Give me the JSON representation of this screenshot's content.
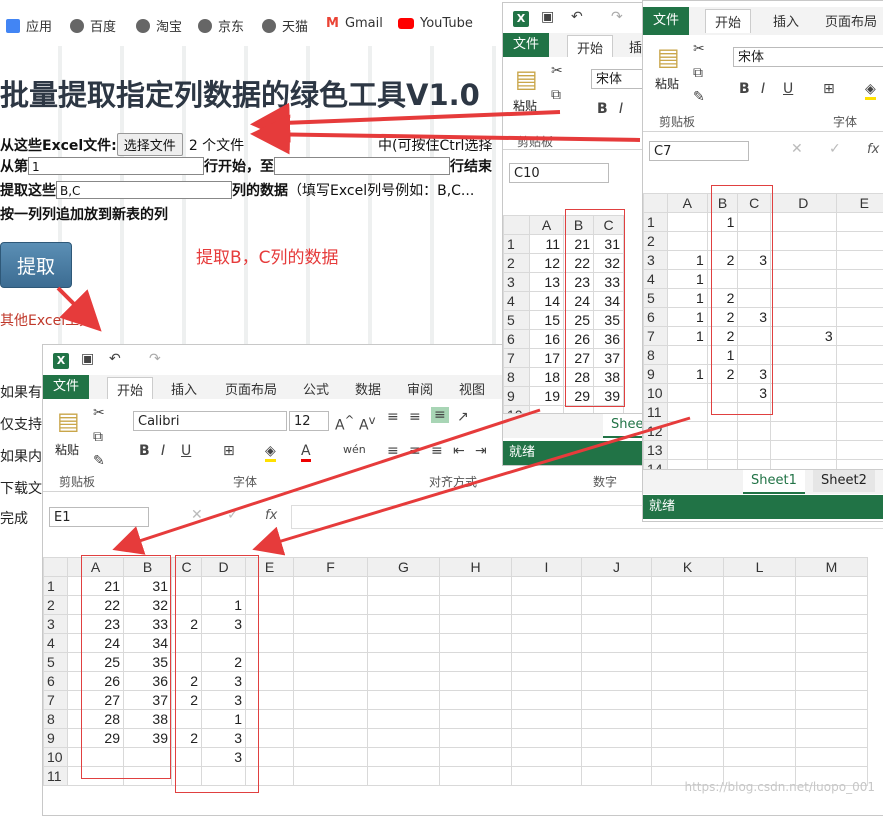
{
  "bookmarks": [
    {
      "label": "应用",
      "color": "#4285f4"
    },
    {
      "label": "百度",
      "color": "#555"
    },
    {
      "label": "淘宝",
      "color": "#555"
    },
    {
      "label": "京东",
      "color": "#555"
    },
    {
      "label": "天猫",
      "color": "#555"
    },
    {
      "label": "Gmail",
      "color": "#ea4335"
    },
    {
      "label": "YouTube",
      "color": "#ff0000"
    }
  ],
  "page": {
    "title": "批量提取指定列数据的绿色工具V1.0",
    "from_files_label": "从这些Excel文件:",
    "choose_file_button": "选择文件",
    "file_count": "2 个文件",
    "ctrl_hint": "中(可按住Ctrl选择",
    "from_row_prefix": "从第",
    "from_row_value": "1",
    "from_row_mid": "行开始，至",
    "from_row_suffix": "行结束",
    "extract_prefix": "提取这些",
    "extract_value": "B,C",
    "extract_suffix": "列的数据",
    "extract_hint": "（填写Excel列号例如：B,C...",
    "append_label": "按一列列追加放到新表的列",
    "extract_button": "提取",
    "annotation": "提取B，C列的数据",
    "other_link": "其他Excel工具",
    "stubs": [
      "如果有",
      "仅支持",
      "如果内",
      "下载文",
      "完成"
    ]
  },
  "win1": {
    "tabs": {
      "file": "文件",
      "home": "开始",
      "insert": "插入",
      "layout": "页面布局",
      "formula": "公式",
      "data": "数据",
      "review": "审阅",
      "view": "视图"
    },
    "groups": {
      "clipboard": "剪贴板",
      "font": "字体",
      "align": "对齐方式",
      "number": "数字"
    },
    "paste": "粘贴",
    "font_name": "Calibri",
    "font_size": "12",
    "namebox": "E1",
    "fx": "fx",
    "columns": [
      "A",
      "B",
      "C",
      "D",
      "E",
      "F",
      "G",
      "H",
      "I",
      "J",
      "K",
      "L",
      "M"
    ],
    "rows": [
      {
        "n": "1",
        "A": "21",
        "B": "31",
        "C": "",
        "D": ""
      },
      {
        "n": "2",
        "A": "22",
        "B": "32",
        "C": "",
        "D": "1"
      },
      {
        "n": "3",
        "A": "23",
        "B": "33",
        "C": "2",
        "D": "3"
      },
      {
        "n": "4",
        "A": "24",
        "B": "34",
        "C": "",
        "D": ""
      },
      {
        "n": "5",
        "A": "25",
        "B": "35",
        "C": "",
        "D": "2"
      },
      {
        "n": "6",
        "A": "26",
        "B": "36",
        "C": "2",
        "D": "3"
      },
      {
        "n": "7",
        "A": "27",
        "B": "37",
        "C": "2",
        "D": "3"
      },
      {
        "n": "8",
        "A": "28",
        "B": "38",
        "C": "",
        "D": "1"
      },
      {
        "n": "9",
        "A": "29",
        "B": "39",
        "C": "2",
        "D": "3"
      },
      {
        "n": "10",
        "A": "",
        "B": "",
        "C": "",
        "D": "3"
      },
      {
        "n": "11",
        "A": "",
        "B": "",
        "C": "",
        "D": ""
      }
    ]
  },
  "win2": {
    "tabs": {
      "file": "文件",
      "home": "开始",
      "insert": "插"
    },
    "font_name": "宋体",
    "paste": "粘贴",
    "group": "剪贴板",
    "namebox": "C10",
    "columns": [
      "A",
      "B",
      "C"
    ],
    "rows": [
      {
        "n": "1",
        "A": "11",
        "B": "21",
        "C": "31"
      },
      {
        "n": "2",
        "A": "12",
        "B": "22",
        "C": "32"
      },
      {
        "n": "3",
        "A": "13",
        "B": "23",
        "C": "33"
      },
      {
        "n": "4",
        "A": "14",
        "B": "24",
        "C": "34"
      },
      {
        "n": "5",
        "A": "15",
        "B": "25",
        "C": "35"
      },
      {
        "n": "6",
        "A": "16",
        "B": "26",
        "C": "36"
      },
      {
        "n": "7",
        "A": "17",
        "B": "27",
        "C": "37"
      },
      {
        "n": "8",
        "A": "18",
        "B": "28",
        "C": "38"
      },
      {
        "n": "9",
        "A": "19",
        "B": "29",
        "C": "39"
      },
      {
        "n": "10",
        "A": "",
        "B": "",
        "C": ""
      }
    ],
    "sheet": "Shee",
    "status": "就绪"
  },
  "win3": {
    "tabs": {
      "file": "文件",
      "home": "开始",
      "insert": "插入",
      "layout": "页面布局"
    },
    "paste": "粘贴",
    "font_name": "宋体",
    "groups": {
      "clipboard": "剪贴板",
      "font": "字体"
    },
    "namebox": "C7",
    "fx": "fx",
    "columns": [
      "A",
      "B",
      "C",
      "D",
      "E"
    ],
    "rows": [
      {
        "n": "1",
        "A": "",
        "B": "1",
        "C": "",
        "D": ""
      },
      {
        "n": "2",
        "A": "",
        "B": "",
        "C": "",
        "D": ""
      },
      {
        "n": "3",
        "A": "1",
        "B": "2",
        "C": "3",
        "D": ""
      },
      {
        "n": "4",
        "A": "1",
        "B": "",
        "C": "",
        "D": ""
      },
      {
        "n": "5",
        "A": "1",
        "B": "2",
        "C": "",
        "D": ""
      },
      {
        "n": "6",
        "A": "1",
        "B": "2",
        "C": "3",
        "D": ""
      },
      {
        "n": "7",
        "A": "1",
        "B": "2",
        "C": "",
        "D": "3"
      },
      {
        "n": "8",
        "A": "",
        "B": "1",
        "C": "",
        "D": ""
      },
      {
        "n": "9",
        "A": "1",
        "B": "2",
        "C": "3",
        "D": ""
      },
      {
        "n": "10",
        "A": "",
        "B": "",
        "C": "3",
        "D": ""
      },
      {
        "n": "11",
        "A": "",
        "B": "",
        "C": "",
        "D": ""
      },
      {
        "n": "12",
        "A": "",
        "B": "",
        "C": "",
        "D": ""
      },
      {
        "n": "13",
        "A": "",
        "B": "",
        "C": "",
        "D": ""
      },
      {
        "n": "14",
        "A": "",
        "B": "",
        "C": "",
        "D": ""
      }
    ],
    "sheets": [
      "Sheet1",
      "Sheet2"
    ],
    "status": "就绪"
  },
  "watermark": "https://blog.csdn.net/luopo_001",
  "colors": {
    "excel_green": "#217346",
    "arrow_red": "#e63b3b"
  }
}
